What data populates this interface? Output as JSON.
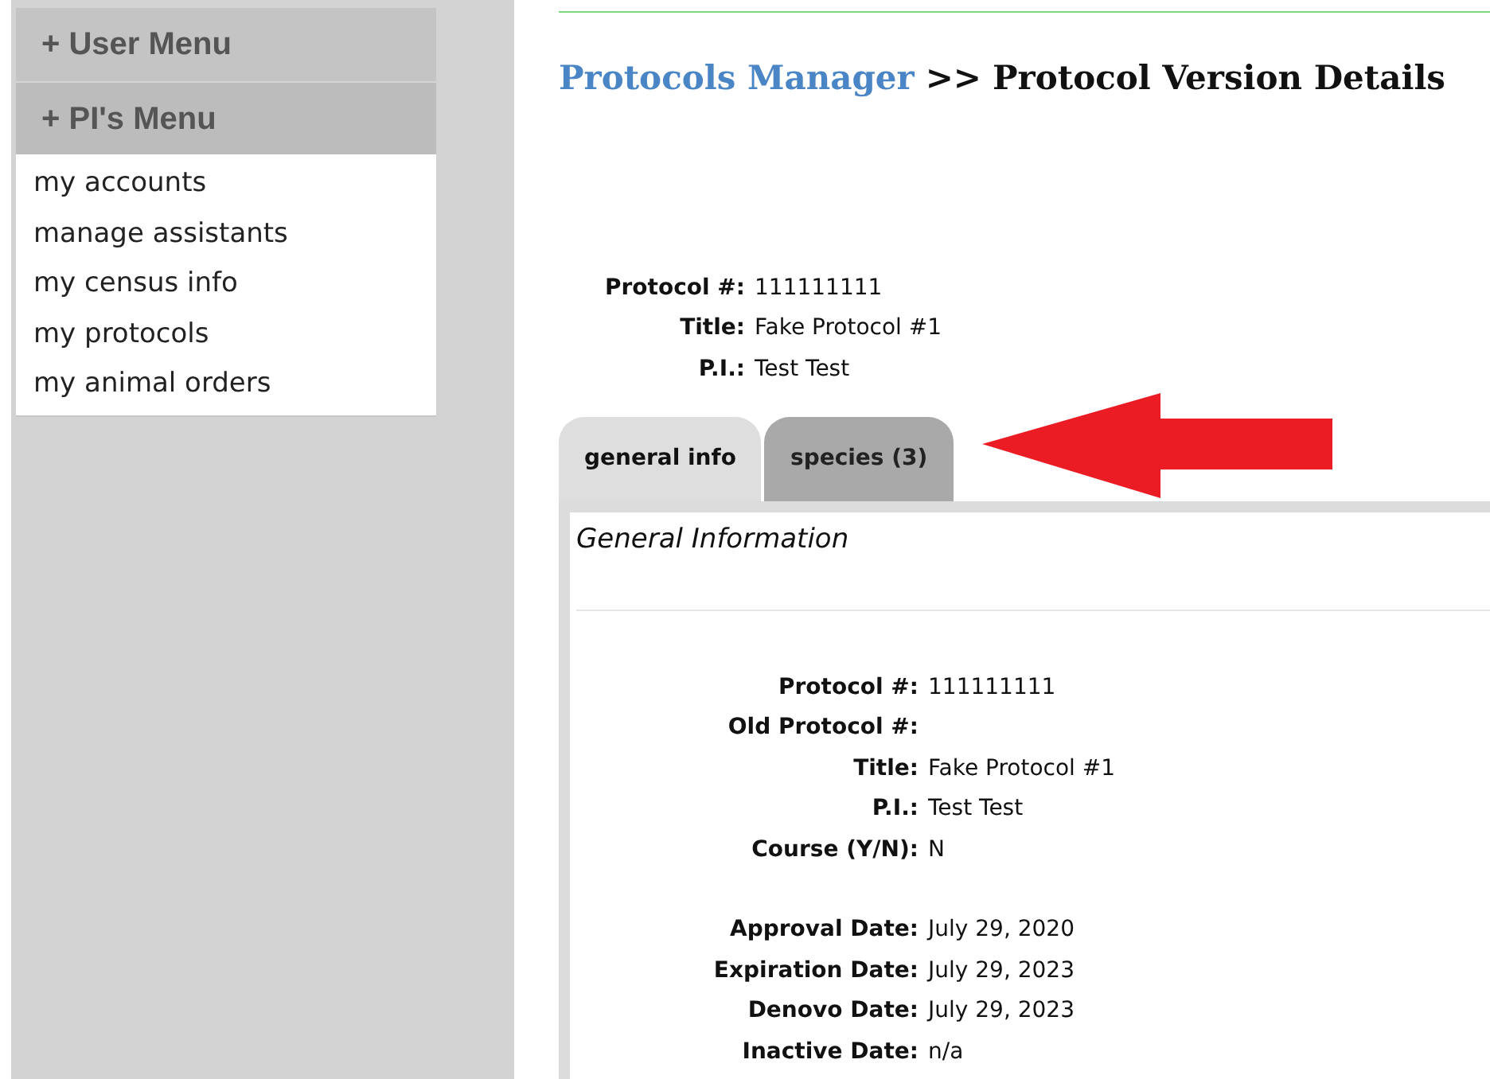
{
  "sidebar": {
    "menus": [
      {
        "label": "+ User Menu"
      },
      {
        "label": "+ PI's Menu",
        "items": [
          "my accounts",
          "manage assistants",
          "my census info",
          "my protocols",
          "my animal orders"
        ]
      }
    ]
  },
  "breadcrumb": {
    "link": "Protocols Manager",
    "separator": ">>",
    "current": "Protocol Version Details"
  },
  "summary": [
    {
      "label": "Protocol #:",
      "value": "111111111"
    },
    {
      "label": "Title:",
      "value": "Fake Protocol #1"
    },
    {
      "label": "P.I.:",
      "value": "Test Test"
    }
  ],
  "tabs": [
    {
      "label": "general info",
      "selected": true
    },
    {
      "label": "species (3)",
      "selected": false
    }
  ],
  "panel": {
    "heading": "General Information",
    "detail_groups": [
      [
        {
          "label": "Protocol #:",
          "value": "111111111"
        },
        {
          "label": "Old Protocol #:"
        },
        {
          "label": "Title:",
          "value": "Fake Protocol #1"
        },
        {
          "label": "P.I.:",
          "value": "Test Test"
        },
        {
          "label": "Course (Y/N):",
          "value": "N"
        }
      ],
      [
        {
          "label": "Approval Date:",
          "value": "July 29, 2020"
        },
        {
          "label": "Expiration Date:",
          "value": "July 29, 2023"
        },
        {
          "label": "Denovo Date:",
          "value": "July 29, 2023"
        },
        {
          "label": "Inactive Date:",
          "value": "n/a"
        }
      ]
    ]
  }
}
